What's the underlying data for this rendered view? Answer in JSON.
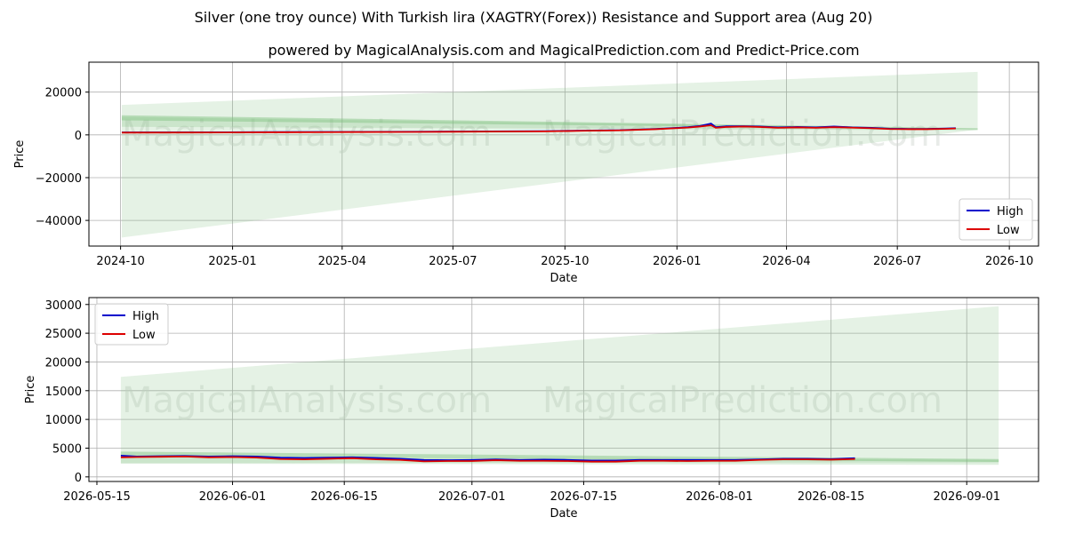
{
  "title": "Silver (one troy ounce) With Turkish lira (XAGTRY(Forex)) Resistance and Support area (Aug 20)",
  "subtitle": "powered by MagicalAnalysis.com and MagicalPrediction.com and Predict-Price.com",
  "watermarks": [
    "MagicalAnalysis.com",
    "MagicalPrediction.com"
  ],
  "colors": {
    "high": "#0000cc",
    "low": "#dd0000",
    "band_fill": "#7fc07f",
    "grid": "#b0b0b0"
  },
  "chart_data": [
    {
      "type": "line",
      "xlabel": "Date",
      "ylabel": "Price",
      "x_tick_labels": [
        "2024-10",
        "2025-01",
        "2025-04",
        "2025-07",
        "2025-10",
        "2026-01",
        "2026-04",
        "2026-07",
        "2026-10"
      ],
      "x_ticks": [
        "2024-10-01",
        "2025-01-01",
        "2025-04-01",
        "2025-07-01",
        "2025-10-01",
        "2026-01-01",
        "2026-04-01",
        "2026-07-01",
        "2026-10-01"
      ],
      "y_ticks": [
        20000,
        0,
        -20000,
        -40000
      ],
      "y_tick_labels": [
        "20000",
        "0",
        "−20000",
        "−40000"
      ],
      "xlim": [
        "2024-09-05",
        "2026-10-25"
      ],
      "ylim": [
        -52000,
        34000
      ],
      "grid": true,
      "legend": {
        "placement": "lower-right",
        "entries": [
          "High",
          "Low"
        ]
      },
      "series": [
        {
          "name": "High",
          "x": [
            "2024-10-02",
            "2024-12-01",
            "2025-02-01",
            "2025-04-01",
            "2025-06-01",
            "2025-08-01",
            "2025-09-15",
            "2025-10-15",
            "2025-11-15",
            "2025-12-15",
            "2026-01-01",
            "2026-01-10",
            "2026-01-20",
            "2026-01-29",
            "2026-02-02",
            "2026-02-10",
            "2026-02-25",
            "2026-03-10",
            "2026-03-25",
            "2026-04-10",
            "2026-04-25",
            "2026-05-10",
            "2026-05-25",
            "2026-06-10",
            "2026-06-25",
            "2026-07-10",
            "2026-07-25",
            "2026-08-10",
            "2026-08-18"
          ],
          "values": [
            1150,
            1200,
            1300,
            1400,
            1500,
            1650,
            1750,
            2000,
            2200,
            2800,
            3300,
            3600,
            4200,
            5300,
            3600,
            4000,
            4100,
            3900,
            3500,
            3700,
            3500,
            3900,
            3500,
            3300,
            2900,
            2800,
            2800,
            3000,
            3150
          ]
        },
        {
          "name": "Low",
          "x": [
            "2024-10-02",
            "2024-12-01",
            "2025-02-01",
            "2025-04-01",
            "2025-06-01",
            "2025-08-01",
            "2025-09-15",
            "2025-10-15",
            "2025-11-15",
            "2025-12-15",
            "2026-01-01",
            "2026-01-10",
            "2026-01-20",
            "2026-01-29",
            "2026-02-02",
            "2026-02-10",
            "2026-02-25",
            "2026-03-10",
            "2026-03-25",
            "2026-04-10",
            "2026-04-25",
            "2026-05-10",
            "2026-05-25",
            "2026-06-10",
            "2026-06-25",
            "2026-07-10",
            "2026-07-25",
            "2026-08-10",
            "2026-08-18"
          ],
          "values": [
            1050,
            1100,
            1200,
            1300,
            1400,
            1550,
            1650,
            1900,
            2100,
            2650,
            3150,
            3400,
            3900,
            4500,
            3300,
            3700,
            3900,
            3700,
            3300,
            3500,
            3300,
            3600,
            3350,
            3100,
            2750,
            2650,
            2650,
            2850,
            3000
          ]
        }
      ],
      "bands": [
        {
          "x": [
            "2024-10-02",
            "2026-09-05"
          ],
          "upper": [
            14000,
            29500
          ],
          "lower": [
            -48000,
            2500
          ],
          "opacity": 0.2
        },
        {
          "x": [
            "2024-10-02",
            "2026-09-05"
          ],
          "upper": [
            9200,
            3100
          ],
          "lower": [
            6800,
            2600
          ],
          "opacity": 0.45
        },
        {
          "x": [
            "2024-10-02",
            "2026-09-05"
          ],
          "upper": [
            8400,
            2950
          ],
          "lower": [
            3800,
            2100
          ],
          "opacity": 0.25
        }
      ]
    },
    {
      "type": "line",
      "xlabel": "Date",
      "ylabel": "Price",
      "x_tick_labels": [
        "2026-05-15",
        "2026-06-01",
        "2026-06-15",
        "2026-07-01",
        "2026-07-15",
        "2026-08-01",
        "2026-08-15",
        "2026-09-01"
      ],
      "x_ticks": [
        "2026-05-15",
        "2026-06-01",
        "2026-06-15",
        "2026-07-01",
        "2026-07-15",
        "2026-08-01",
        "2026-08-15",
        "2026-09-01"
      ],
      "y_ticks": [
        30000,
        25000,
        20000,
        15000,
        10000,
        5000,
        0
      ],
      "y_tick_labels": [
        "30000",
        "25000",
        "20000",
        "15000",
        "10000",
        "5000",
        "0"
      ],
      "xlim": [
        "2026-05-14",
        "2026-09-10"
      ],
      "ylim": [
        -800,
        31200
      ],
      "grid": true,
      "legend": {
        "placement": "upper-left",
        "entries": [
          "High",
          "Low"
        ]
      },
      "series": [
        {
          "name": "High",
          "x": [
            "2026-05-18",
            "2026-05-20",
            "2026-05-23",
            "2026-05-26",
            "2026-05-29",
            "2026-06-01",
            "2026-06-04",
            "2026-06-07",
            "2026-06-10",
            "2026-06-13",
            "2026-06-16",
            "2026-06-19",
            "2026-06-22",
            "2026-06-25",
            "2026-06-28",
            "2026-07-01",
            "2026-07-04",
            "2026-07-07",
            "2026-07-10",
            "2026-07-13",
            "2026-07-16",
            "2026-07-19",
            "2026-07-22",
            "2026-07-25",
            "2026-07-28",
            "2026-07-31",
            "2026-08-03",
            "2026-08-06",
            "2026-08-09",
            "2026-08-12",
            "2026-08-15",
            "2026-08-18"
          ],
          "values": [
            3700,
            3550,
            3600,
            3650,
            3550,
            3600,
            3550,
            3350,
            3300,
            3350,
            3400,
            3300,
            3150,
            2950,
            2900,
            2950,
            3050,
            2950,
            3000,
            2950,
            2850,
            2850,
            2950,
            2950,
            2950,
            2950,
            2950,
            3050,
            3150,
            3150,
            3100,
            3250
          ]
        },
        {
          "name": "Low",
          "x": [
            "2026-05-18",
            "2026-05-20",
            "2026-05-23",
            "2026-05-26",
            "2026-05-29",
            "2026-06-01",
            "2026-06-04",
            "2026-06-07",
            "2026-06-10",
            "2026-06-13",
            "2026-06-16",
            "2026-06-19",
            "2026-06-22",
            "2026-06-25",
            "2026-06-28",
            "2026-07-01",
            "2026-07-04",
            "2026-07-07",
            "2026-07-10",
            "2026-07-13",
            "2026-07-16",
            "2026-07-19",
            "2026-07-22",
            "2026-07-25",
            "2026-07-28",
            "2026-07-31",
            "2026-08-03",
            "2026-08-06",
            "2026-08-09",
            "2026-08-12",
            "2026-08-15",
            "2026-08-18"
          ],
          "values": [
            3400,
            3450,
            3500,
            3550,
            3400,
            3450,
            3350,
            3100,
            3050,
            3150,
            3250,
            3050,
            2950,
            2700,
            2750,
            2750,
            2900,
            2800,
            2800,
            2750,
            2650,
            2650,
            2800,
            2800,
            2750,
            2800,
            2800,
            2950,
            3050,
            3050,
            3000,
            3100
          ]
        }
      ],
      "bands": [
        {
          "x": [
            "2026-05-18",
            "2026-09-05"
          ],
          "upper": [
            17400,
            29700
          ],
          "lower": [
            2400,
            2500
          ],
          "opacity": 0.2
        },
        {
          "x": [
            "2026-05-18",
            "2026-09-05"
          ],
          "upper": [
            4400,
            3100
          ],
          "lower": [
            3700,
            2600
          ],
          "opacity": 0.45
        },
        {
          "x": [
            "2026-05-18",
            "2026-09-05"
          ],
          "upper": [
            3600,
            2950
          ],
          "lower": [
            2300,
            2100
          ],
          "opacity": 0.25
        }
      ]
    }
  ]
}
